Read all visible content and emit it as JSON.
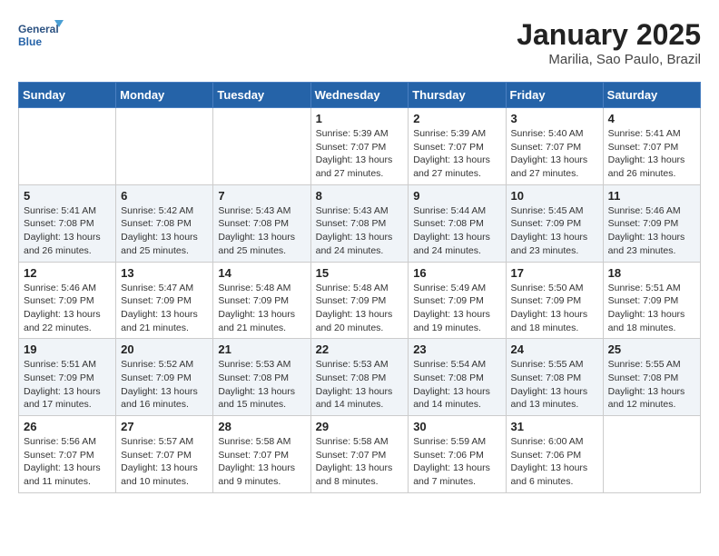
{
  "header": {
    "logo_line1": "General",
    "logo_line2": "Blue",
    "month": "January 2025",
    "location": "Marilia, Sao Paulo, Brazil"
  },
  "days_of_week": [
    "Sunday",
    "Monday",
    "Tuesday",
    "Wednesday",
    "Thursday",
    "Friday",
    "Saturday"
  ],
  "weeks": [
    [
      {
        "day": "",
        "info": ""
      },
      {
        "day": "",
        "info": ""
      },
      {
        "day": "",
        "info": ""
      },
      {
        "day": "1",
        "info": "Sunrise: 5:39 AM\nSunset: 7:07 PM\nDaylight: 13 hours\nand 27 minutes."
      },
      {
        "day": "2",
        "info": "Sunrise: 5:39 AM\nSunset: 7:07 PM\nDaylight: 13 hours\nand 27 minutes."
      },
      {
        "day": "3",
        "info": "Sunrise: 5:40 AM\nSunset: 7:07 PM\nDaylight: 13 hours\nand 27 minutes."
      },
      {
        "day": "4",
        "info": "Sunrise: 5:41 AM\nSunset: 7:07 PM\nDaylight: 13 hours\nand 26 minutes."
      }
    ],
    [
      {
        "day": "5",
        "info": "Sunrise: 5:41 AM\nSunset: 7:08 PM\nDaylight: 13 hours\nand 26 minutes."
      },
      {
        "day": "6",
        "info": "Sunrise: 5:42 AM\nSunset: 7:08 PM\nDaylight: 13 hours\nand 25 minutes."
      },
      {
        "day": "7",
        "info": "Sunrise: 5:43 AM\nSunset: 7:08 PM\nDaylight: 13 hours\nand 25 minutes."
      },
      {
        "day": "8",
        "info": "Sunrise: 5:43 AM\nSunset: 7:08 PM\nDaylight: 13 hours\nand 24 minutes."
      },
      {
        "day": "9",
        "info": "Sunrise: 5:44 AM\nSunset: 7:08 PM\nDaylight: 13 hours\nand 24 minutes."
      },
      {
        "day": "10",
        "info": "Sunrise: 5:45 AM\nSunset: 7:09 PM\nDaylight: 13 hours\nand 23 minutes."
      },
      {
        "day": "11",
        "info": "Sunrise: 5:46 AM\nSunset: 7:09 PM\nDaylight: 13 hours\nand 23 minutes."
      }
    ],
    [
      {
        "day": "12",
        "info": "Sunrise: 5:46 AM\nSunset: 7:09 PM\nDaylight: 13 hours\nand 22 minutes."
      },
      {
        "day": "13",
        "info": "Sunrise: 5:47 AM\nSunset: 7:09 PM\nDaylight: 13 hours\nand 21 minutes."
      },
      {
        "day": "14",
        "info": "Sunrise: 5:48 AM\nSunset: 7:09 PM\nDaylight: 13 hours\nand 21 minutes."
      },
      {
        "day": "15",
        "info": "Sunrise: 5:48 AM\nSunset: 7:09 PM\nDaylight: 13 hours\nand 20 minutes."
      },
      {
        "day": "16",
        "info": "Sunrise: 5:49 AM\nSunset: 7:09 PM\nDaylight: 13 hours\nand 19 minutes."
      },
      {
        "day": "17",
        "info": "Sunrise: 5:50 AM\nSunset: 7:09 PM\nDaylight: 13 hours\nand 18 minutes."
      },
      {
        "day": "18",
        "info": "Sunrise: 5:51 AM\nSunset: 7:09 PM\nDaylight: 13 hours\nand 18 minutes."
      }
    ],
    [
      {
        "day": "19",
        "info": "Sunrise: 5:51 AM\nSunset: 7:09 PM\nDaylight: 13 hours\nand 17 minutes."
      },
      {
        "day": "20",
        "info": "Sunrise: 5:52 AM\nSunset: 7:09 PM\nDaylight: 13 hours\nand 16 minutes."
      },
      {
        "day": "21",
        "info": "Sunrise: 5:53 AM\nSunset: 7:08 PM\nDaylight: 13 hours\nand 15 minutes."
      },
      {
        "day": "22",
        "info": "Sunrise: 5:53 AM\nSunset: 7:08 PM\nDaylight: 13 hours\nand 14 minutes."
      },
      {
        "day": "23",
        "info": "Sunrise: 5:54 AM\nSunset: 7:08 PM\nDaylight: 13 hours\nand 14 minutes."
      },
      {
        "day": "24",
        "info": "Sunrise: 5:55 AM\nSunset: 7:08 PM\nDaylight: 13 hours\nand 13 minutes."
      },
      {
        "day": "25",
        "info": "Sunrise: 5:55 AM\nSunset: 7:08 PM\nDaylight: 13 hours\nand 12 minutes."
      }
    ],
    [
      {
        "day": "26",
        "info": "Sunrise: 5:56 AM\nSunset: 7:07 PM\nDaylight: 13 hours\nand 11 minutes."
      },
      {
        "day": "27",
        "info": "Sunrise: 5:57 AM\nSunset: 7:07 PM\nDaylight: 13 hours\nand 10 minutes."
      },
      {
        "day": "28",
        "info": "Sunrise: 5:58 AM\nSunset: 7:07 PM\nDaylight: 13 hours\nand 9 minutes."
      },
      {
        "day": "29",
        "info": "Sunrise: 5:58 AM\nSunset: 7:07 PM\nDaylight: 13 hours\nand 8 minutes."
      },
      {
        "day": "30",
        "info": "Sunrise: 5:59 AM\nSunset: 7:06 PM\nDaylight: 13 hours\nand 7 minutes."
      },
      {
        "day": "31",
        "info": "Sunrise: 6:00 AM\nSunset: 7:06 PM\nDaylight: 13 hours\nand 6 minutes."
      },
      {
        "day": "",
        "info": ""
      }
    ]
  ]
}
